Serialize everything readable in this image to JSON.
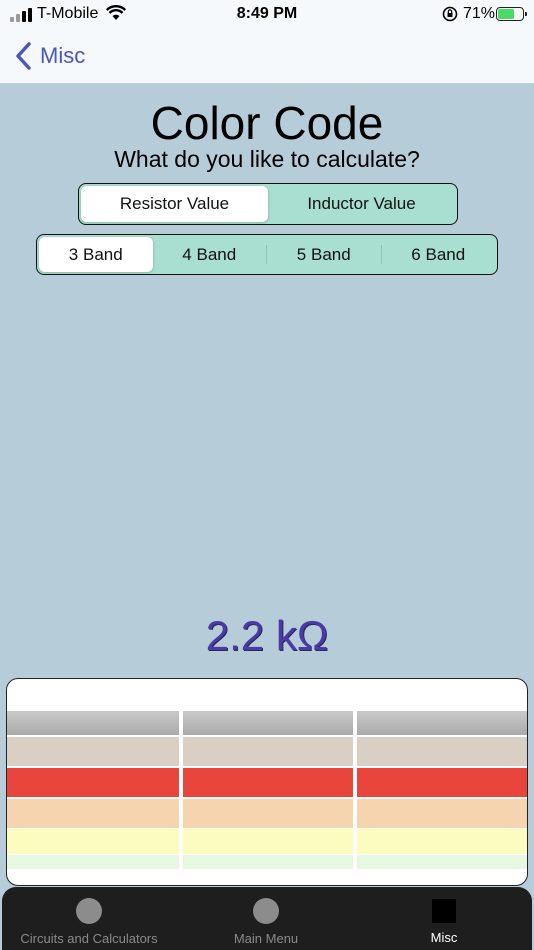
{
  "status_bar": {
    "carrier": "T-Mobile",
    "time": "8:49 PM",
    "battery_percent": "71%",
    "battery_level": 0.71
  },
  "nav": {
    "back_label": "Misc"
  },
  "header": {
    "title": "Color Code",
    "subtitle": "What do you like to calculate?"
  },
  "calc_type": {
    "options": [
      "Resistor Value",
      "Inductor Value"
    ],
    "selected": "Resistor Value"
  },
  "band_count": {
    "options": [
      "3 Band",
      "4 Band",
      "5 Band",
      "6 Band"
    ],
    "selected": "3 Band"
  },
  "result": {
    "value": "2.2 kΩ"
  },
  "picker": {
    "bands": [
      {
        "selected_color": "red"
      },
      {
        "selected_color": "red"
      },
      {
        "selected_color": "red"
      }
    ],
    "visible_colors": [
      "#a9a9a9",
      "#d9cfc4",
      "#e8453c",
      "#f6d4b0",
      "#fdfcbf",
      "#e6f8df"
    ]
  },
  "tab_bar": {
    "tabs": [
      {
        "label": "Circuits and Calculators",
        "icon": "circle-icon"
      },
      {
        "label": "Main Menu",
        "icon": "circle-icon"
      },
      {
        "label": "Misc",
        "icon": "square-icon"
      }
    ],
    "active": "Misc"
  }
}
